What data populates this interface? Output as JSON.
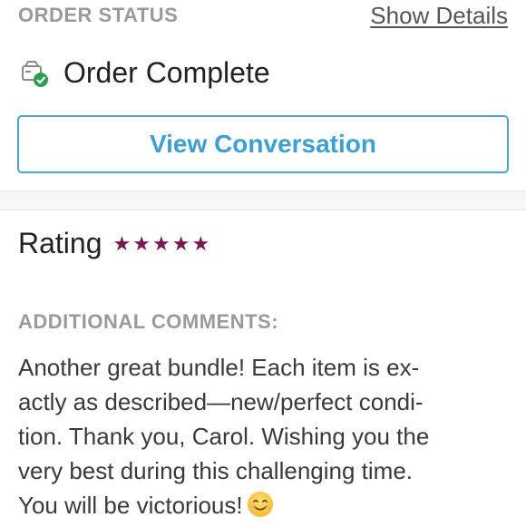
{
  "order_status": {
    "section_label": "ORDER STATUS",
    "show_details_link": "Show Details",
    "status_text": "Order Complete",
    "status_icon": "package-check-icon",
    "view_conversation_label": "View Conversation"
  },
  "rating": {
    "label": "Rating",
    "stars": 5,
    "max_stars": 5,
    "star_color": "#7a1750"
  },
  "comments": {
    "label": "ADDITIONAL COMMENTS:",
    "lines": [
      "Another great bundle! Each item is ex-",
      "actly as described—new/perfect condi-",
      "tion. Thank you, Carol. Wishing you the",
      "very best during this challenging time.",
      "You will be victorious!"
    ],
    "emoji": "smiling-face-emoji"
  },
  "colors": {
    "accent_blue": "#3d9fd3",
    "muted_label": "#9a9a9a",
    "success_green": "#2e9e4f"
  }
}
